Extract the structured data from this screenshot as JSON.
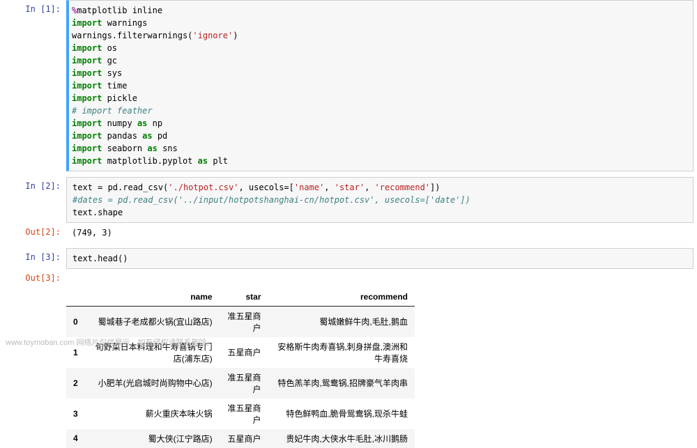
{
  "cells": {
    "c1": {
      "prompt": "In  [1]:",
      "code_html": "<span class=\"kw-purple\">%</span>matplotlib inline\n<span class=\"kw-green\">import</span> warnings\nwarnings.filterwarnings(<span class=\"str-red\">'ignore'</span>)\n<span class=\"kw-green\">import</span> os\n<span class=\"kw-green\">import</span> gc\n<span class=\"kw-green\">import</span> sys\n<span class=\"kw-green\">import</span> time\n<span class=\"kw-green\">import</span> pickle\n<span class=\"comment-it\"># import feather</span>\n<span class=\"kw-green\">import</span> numpy <span class=\"kw-green\">as</span> np\n<span class=\"kw-green\">import</span> pandas <span class=\"kw-green\">as</span> pd\n<span class=\"kw-green\">import</span> seaborn <span class=\"kw-green\">as</span> sns\n<span class=\"kw-green\">import</span> matplotlib.pyplot <span class=\"kw-green\">as</span> plt"
    },
    "c2": {
      "prompt": "In  [2]:",
      "code_html": "text = pd.read_csv(<span class=\"str-red\">'./hotpot.csv'</span>, usecols=[<span class=\"str-red\">'name'</span>, <span class=\"str-red\">'star'</span>, <span class=\"str-red\">'recommend'</span>])\n<span class=\"comment-it\">#dates = pd.read_csv('../input/hotpotshanghai-cn/hotpot.csv', usecols=['date'])</span>\ntext.shape",
      "out_prompt": "Out[2]:",
      "out_text": "(749, 3)"
    },
    "c3": {
      "prompt": "In  [3]:",
      "code_html": "text.head()",
      "out_prompt": "Out[3]:"
    }
  },
  "table": {
    "columns": [
      "name",
      "star",
      "recommend"
    ],
    "rows": [
      {
        "idx": "0",
        "name": "蜀城巷子老成都火锅(宜山路店)",
        "star": "准五星商户",
        "recommend": "蜀城嫩鲜牛肉,毛肚,鹅血"
      },
      {
        "idx": "1",
        "name": "旬野菜日本料理和牛寿喜锅专门店(浦东店)",
        "star": "五星商户",
        "recommend": "安格斯牛肉寿喜锅,刺身拼盘,澳洲和牛寿喜烧"
      },
      {
        "idx": "2",
        "name": "小肥羊(光启城时尚购物中心店)",
        "star": "准五星商户",
        "recommend": "特色羔羊肉,鸳鸯锅,招牌豪气羊肉串"
      },
      {
        "idx": "3",
        "name": "薪火重庆本味火锅",
        "star": "准五星商户",
        "recommend": "特色鲜鸭血,脆骨鸳鸯锅,现杀牛蛙"
      },
      {
        "idx": "4",
        "name": "蜀大侠(江宁路店)",
        "star": "五星商户",
        "recommend": "贵妃牛肉,大侠水牛毛肚,冰川鹅肠"
      }
    ]
  },
  "watermark": "www.toymoban.com 网络片仅供展示，如有侵权请联系删除。"
}
